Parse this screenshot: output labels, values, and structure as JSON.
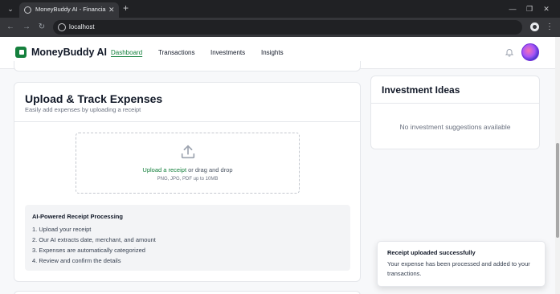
{
  "browser": {
    "tab_title": "MoneyBuddy AI - Financial Ma",
    "new_tab": "+",
    "tab_close": "✕",
    "url": "localhost",
    "window_controls": {
      "minimize": "—",
      "restore": "❐",
      "close": "✕"
    }
  },
  "app": {
    "brand": "MoneyBuddy AI",
    "nav": [
      {
        "label": "Dashboard",
        "active": true
      },
      {
        "label": "Transactions",
        "active": false
      },
      {
        "label": "Investments",
        "active": false
      },
      {
        "label": "Insights",
        "active": false
      }
    ],
    "icons": {
      "notifications": "bell-icon",
      "profile": "avatar"
    },
    "accent_color": "#15803d"
  },
  "upload": {
    "title": "Upload & Track Expenses",
    "subtitle": "Easily add expenses by uploading a receipt",
    "link_text": "Upload a receipt",
    "drop_text": " or drag and drop",
    "hint": "PNG, JPG, PDF up to 10MB",
    "info_title": "AI-Powered Receipt Processing",
    "steps": [
      "1. Upload your receipt",
      "2. Our AI extracts date, merchant, and amount",
      "3. Expenses are automatically categorized",
      "4. Review and confirm the details"
    ]
  },
  "investments": {
    "title": "Investment Ideas",
    "empty": "No investment suggestions available"
  },
  "toast": {
    "title": "Receipt uploaded successfully",
    "message": "Your expense has been processed and added to your transactions."
  }
}
